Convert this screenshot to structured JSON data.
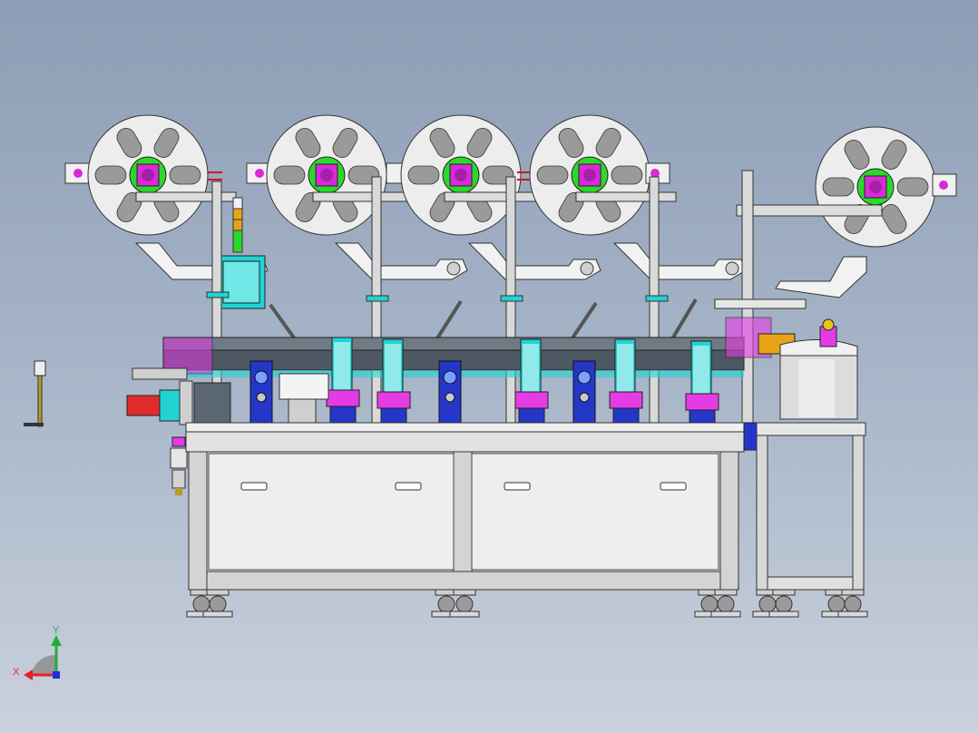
{
  "viewport": {
    "background_top": "#8c9db5",
    "background_bottom": "#c9d1dc"
  },
  "triad": {
    "x_label": "X",
    "y_label": "Y",
    "x_color": "#e8202a",
    "y_color": "#1fae3b",
    "z_color": "#1e2fd6"
  },
  "colors": {
    "reel": "#ededed",
    "reel_outline": "#333333",
    "hub_green": "#2bd82b",
    "hub_magenta": "#d82bd8",
    "cyan": "#22d3d3",
    "magenta": "#e53be5",
    "blue": "#2437c9",
    "frame": "#e6e6e6",
    "red_arm": "#c81e1e"
  },
  "icons": {
    "triad": "coordinate-triad-icon",
    "reel": "tape-reel-icon"
  }
}
